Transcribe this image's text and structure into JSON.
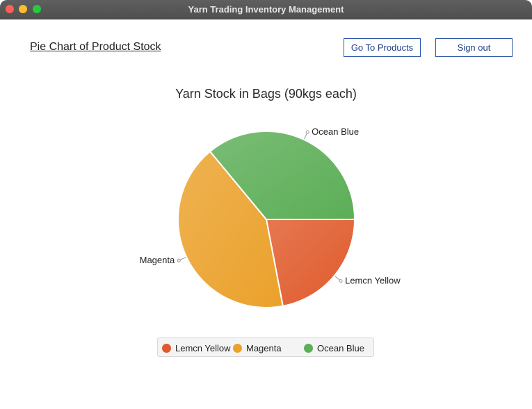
{
  "window": {
    "title": "Yarn Trading Inventory Management"
  },
  "header": {
    "page_heading": "Pie Chart of Product Stock",
    "products_button": "Go To Products",
    "signout_button": "Sign out"
  },
  "chart_data": {
    "type": "pie",
    "title": "Yarn Stock in Bags (90kgs each)",
    "legend_position": "bottom",
    "slices": [
      {
        "label": "Lemcn Yellow",
        "value": 22,
        "color": "#e05a2b"
      },
      {
        "label": "Magenta",
        "value": 42,
        "color": "#eba12b"
      },
      {
        "label": "Ocean Blue",
        "value": 36,
        "color": "#5cae57"
      }
    ]
  }
}
